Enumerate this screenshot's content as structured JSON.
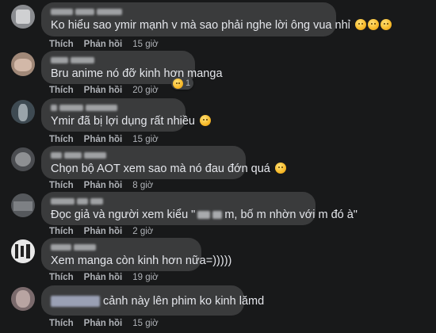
{
  "comments": [
    {
      "text": "Ko hiểu sao ymir mạnh v mà sao phải nghe lời ông vua nhỉ",
      "emoji": "thinking-face",
      "emoji_count_shown": 3,
      "like_label": "Thích",
      "reply_label": "Phản hồi",
      "time": "15 giờ"
    },
    {
      "text": "Bru anime nó đỡ kinh hơn manga",
      "like_label": "Thích",
      "reply_label": "Phản hồi",
      "time": "20 giờ",
      "reaction_icon": "sad-face",
      "reaction_count": "1"
    },
    {
      "text": "Ymir đã bị lợi dụng rất nhiều",
      "emoji": "smiling-face",
      "like_label": "Thích",
      "reply_label": "Phản hồi",
      "time": "15 giờ"
    },
    {
      "text": "Chọn bộ AOT xem sao mà nó đau đớn quá",
      "emoji": "crying-face",
      "like_label": "Thích",
      "reply_label": "Phản hồi",
      "time": "8 giờ"
    },
    {
      "text_start": "Đọc giả và người xem kiểu \"",
      "text_end": "m, bố m nhờn với m đó à\"",
      "like_label": "Thích",
      "reply_label": "Phản hồi",
      "time": "2 giờ"
    },
    {
      "text": "Xem manga còn kinh hơn nữa=)))))",
      "like_label": "Thích",
      "reply_label": "Phản hồi",
      "time": "19 giờ"
    },
    {
      "text": "cảnh này lên phim ko kinh lămd",
      "like_label": "Thích",
      "reply_label": "Phản hồi",
      "time": "15 giờ"
    }
  ],
  "colors": {
    "background": "#18191a",
    "bubble": "#3a3b3c",
    "text": "#e4e6eb",
    "secondary": "#b0b3b8"
  }
}
